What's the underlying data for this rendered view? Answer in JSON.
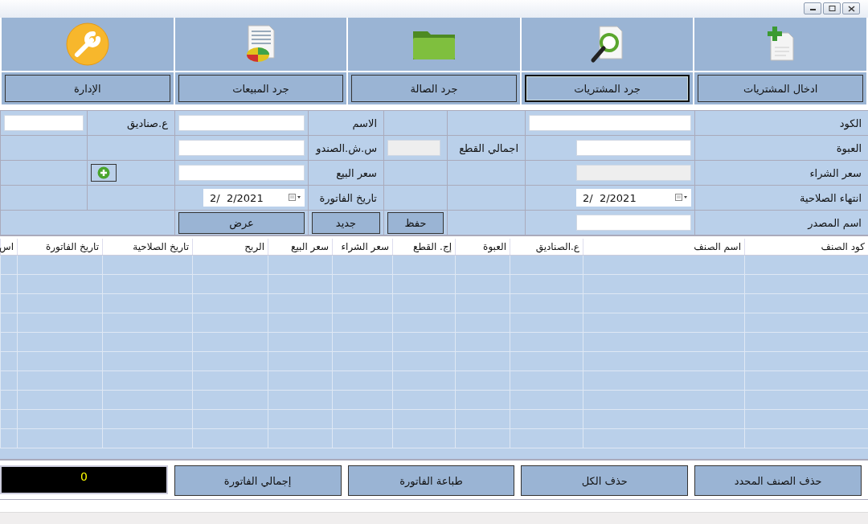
{
  "nav": [
    {
      "label": "ادخال المشتريات",
      "selected": false
    },
    {
      "label": "جرد المشتريات",
      "selected": true
    },
    {
      "label": "جرد الصالة",
      "selected": false
    },
    {
      "label": "جرد المبيعات",
      "selected": false
    },
    {
      "label": "الإدارة",
      "selected": false
    }
  ],
  "form": [
    [
      {
        "kind": "label",
        "text": "الكود"
      },
      {
        "kind": "field-wide"
      },
      {
        "kind": "empty"
      },
      {
        "kind": "empty"
      },
      {
        "kind": "label",
        "text": "الاسم"
      },
      {
        "kind": "field-wide"
      },
      {
        "kind": "label",
        "text": "ع.صناديق"
      },
      {
        "kind": "field-wide"
      }
    ],
    [
      {
        "kind": "label",
        "text": "العبوة"
      },
      {
        "kind": "field"
      },
      {
        "kind": "label",
        "text": "اجمالي القطع"
      },
      {
        "kind": "field-disabled"
      },
      {
        "kind": "label",
        "text": "س.ش.الصندو"
      },
      {
        "kind": "field-wide"
      },
      {
        "kind": "empty"
      },
      {
        "kind": "empty"
      }
    ],
    [
      {
        "kind": "label",
        "text": "سعر الشراء"
      },
      {
        "kind": "field-disabled"
      },
      {
        "kind": "empty"
      },
      {
        "kind": "empty"
      },
      {
        "kind": "label",
        "text": "سعر البيع"
      },
      {
        "kind": "field-wide"
      },
      {
        "kind": "add-button"
      },
      {
        "kind": "empty"
      }
    ],
    [
      {
        "kind": "label",
        "text": "انتهاء الصلاحية"
      },
      {
        "kind": "date",
        "value": "2/  2/2021"
      },
      {
        "kind": "empty"
      },
      {
        "kind": "empty"
      },
      {
        "kind": "label",
        "text": "تاريخ الفاتورة"
      },
      {
        "kind": "date",
        "value": "2/  2/2021"
      },
      {
        "kind": "empty"
      },
      {
        "kind": "empty"
      }
    ],
    [
      {
        "kind": "label",
        "text": "اسم المصدر"
      },
      {
        "kind": "field"
      },
      {
        "kind": "empty"
      },
      {
        "kind": "button",
        "text": "حفظ"
      },
      {
        "kind": "button",
        "text": "جديد"
      },
      {
        "kind": "button",
        "text": "عرض"
      },
      {
        "kind": "empty"
      }
    ]
  ],
  "table": {
    "columns": [
      "كود الصنف",
      "اسم الصنف",
      "ع.الصناديق",
      "العبوة",
      "إج. القطع",
      "سعر الشراء",
      "سعر البيع",
      "الربح",
      "تاريخ الصلاحية",
      "تاريخ الفاتورة",
      "اس"
    ]
  },
  "actions": [
    "حذف الصنف المحدد",
    "حذف الكل",
    "طباعة الفاتورة",
    "إجمالي الفاتورة"
  ],
  "total": "0"
}
